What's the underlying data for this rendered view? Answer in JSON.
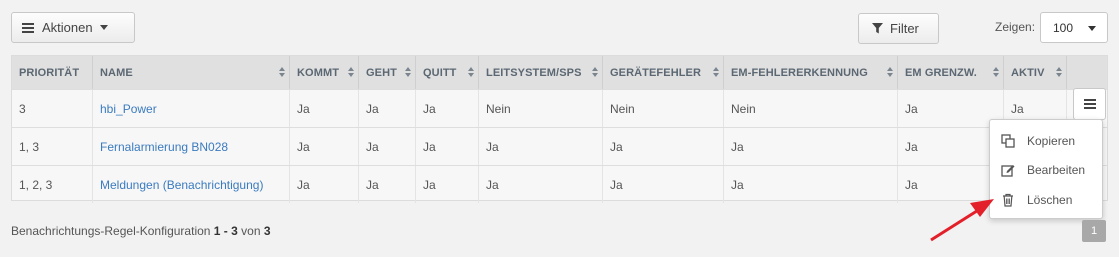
{
  "toolbar": {
    "actions_label": "Aktionen",
    "filter_label": "Filter",
    "show_label": "Zeigen:",
    "show_value": "100"
  },
  "table": {
    "headers": [
      "PRIORITÄT",
      "NAME",
      "KOMMT",
      "GEHT",
      "QUITT",
      "LEITSYSTEM/SPS",
      "GERÄTEFEHLER",
      "EM-FEHLERERKENNUNG",
      "EM GRENZW.",
      "AKTIV"
    ],
    "rows": [
      [
        "3",
        "hbi_Power",
        "Ja",
        "Ja",
        "Ja",
        "Nein",
        "Nein",
        "Nein",
        "Ja",
        "Ja"
      ],
      [
        "1, 3",
        "Fernalarmierung BN028",
        "Ja",
        "Ja",
        "Ja",
        "Ja",
        "Ja",
        "Ja",
        "Ja",
        ""
      ],
      [
        "1, 2, 3",
        "Meldungen (Benachrichtigung)",
        "Ja",
        "Ja",
        "Ja",
        "Ja",
        "Ja",
        "Ja",
        "Ja",
        ""
      ]
    ]
  },
  "row_menu": {
    "items": [
      {
        "label": "Kopieren",
        "icon": "copy-icon"
      },
      {
        "label": "Bearbeiten",
        "icon": "edit-icon"
      },
      {
        "label": "Löschen",
        "icon": "trash-icon"
      }
    ]
  },
  "footer": {
    "prefix": "Benachrichtungs-Regel-Konfiguration",
    "range": "1 - 3",
    "of_label": "von",
    "total": "3",
    "page": "1"
  },
  "colors": {
    "link": "#3b7bbf",
    "arrow": "#e3202a",
    "header_bg": "#e0e0e0"
  }
}
